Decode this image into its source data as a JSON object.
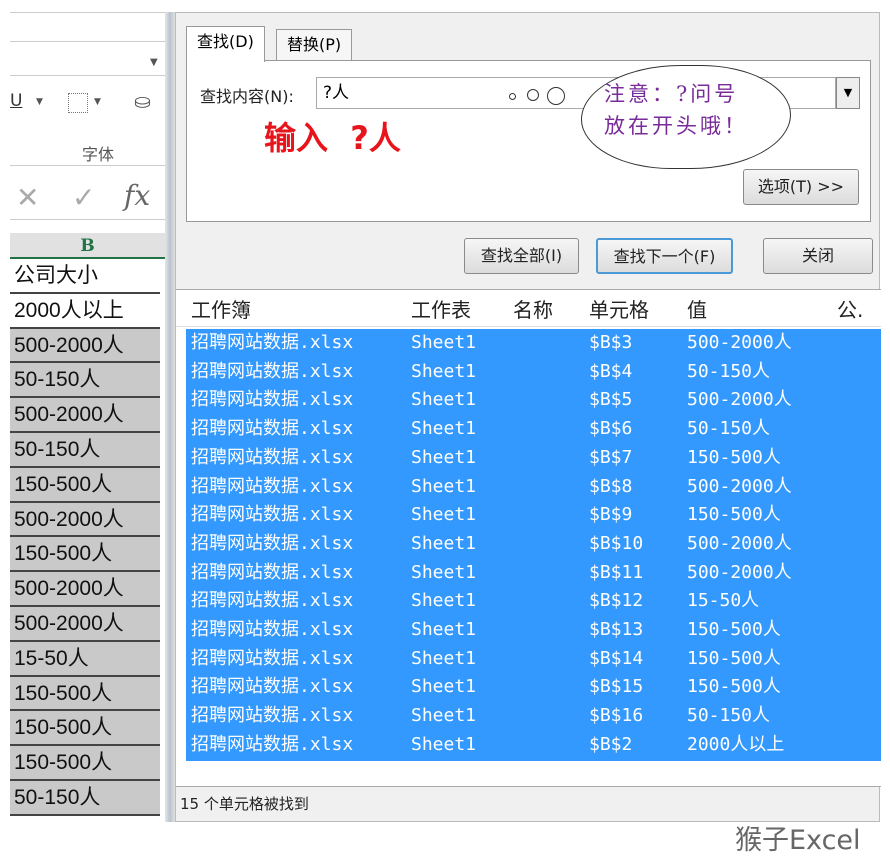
{
  "excel": {
    "ribbon_group": "字体",
    "underline": "U",
    "formula_icons": [
      "cancel-icon",
      "enter-icon",
      "function-icon"
    ],
    "fx": "fx",
    "column_header": "B",
    "cells": [
      "公司大小",
      "2000人以上",
      "500-2000人",
      "50-150人",
      "500-2000人",
      "50-150人",
      "150-500人",
      "500-2000人",
      "150-500人",
      "500-2000人",
      "500-2000人",
      "15-50人",
      "150-500人",
      "150-500人",
      "150-500人",
      "50-150人"
    ]
  },
  "dialog": {
    "tabs": [
      "查找(D)",
      "替换(P)"
    ],
    "find_label": "查找内容(N):",
    "find_value": "?人",
    "options_button": "选项(T) >>",
    "buttons": {
      "find_all": "查找全部(I)",
      "find_next": "查找下一个(F)",
      "close": "关闭"
    },
    "columns": [
      "工作簿",
      "工作表",
      "名称",
      "单元格",
      "值",
      "公."
    ],
    "results": [
      [
        "招聘网站数据.xlsx",
        "Sheet1",
        "",
        "$B$3",
        "500-2000人"
      ],
      [
        "招聘网站数据.xlsx",
        "Sheet1",
        "",
        "$B$4",
        "50-150人"
      ],
      [
        "招聘网站数据.xlsx",
        "Sheet1",
        "",
        "$B$5",
        "500-2000人"
      ],
      [
        "招聘网站数据.xlsx",
        "Sheet1",
        "",
        "$B$6",
        "50-150人"
      ],
      [
        "招聘网站数据.xlsx",
        "Sheet1",
        "",
        "$B$7",
        "150-500人"
      ],
      [
        "招聘网站数据.xlsx",
        "Sheet1",
        "",
        "$B$8",
        "500-2000人"
      ],
      [
        "招聘网站数据.xlsx",
        "Sheet1",
        "",
        "$B$9",
        "150-500人"
      ],
      [
        "招聘网站数据.xlsx",
        "Sheet1",
        "",
        "$B$10",
        "500-2000人"
      ],
      [
        "招聘网站数据.xlsx",
        "Sheet1",
        "",
        "$B$11",
        "500-2000人"
      ],
      [
        "招聘网站数据.xlsx",
        "Sheet1",
        "",
        "$B$12",
        "15-50人"
      ],
      [
        "招聘网站数据.xlsx",
        "Sheet1",
        "",
        "$B$13",
        "150-500人"
      ],
      [
        "招聘网站数据.xlsx",
        "Sheet1",
        "",
        "$B$14",
        "150-500人"
      ],
      [
        "招聘网站数据.xlsx",
        "Sheet1",
        "",
        "$B$15",
        "150-500人"
      ],
      [
        "招聘网站数据.xlsx",
        "Sheet1",
        "",
        "$B$16",
        "50-150人"
      ],
      [
        "招聘网站数据.xlsx",
        "Sheet1",
        "",
        "$B$2",
        "2000人以上"
      ]
    ],
    "status": "15 个单元格被找到"
  },
  "annotation": {
    "red_text": "输入  ?人",
    "cloud_line1": "注意：?问号",
    "cloud_line2": "放在开头哦！"
  },
  "watermark": "猴子Excel",
  "colors": {
    "selection": "#3399ff",
    "annotation_red": "#e8141c",
    "cloud_text": "#7a2b9a"
  }
}
